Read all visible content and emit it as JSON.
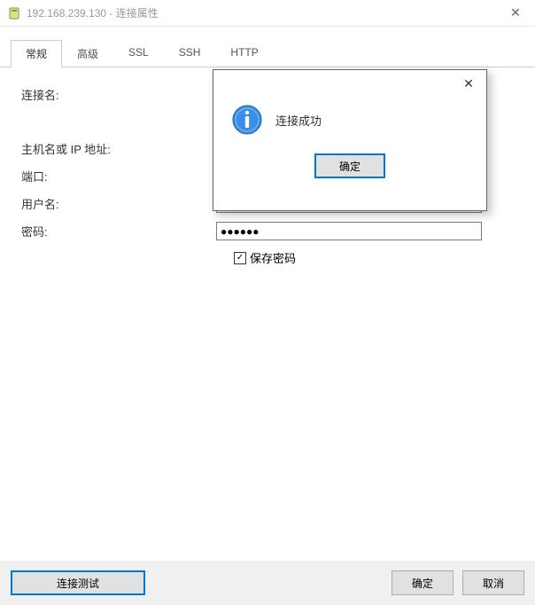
{
  "window": {
    "title": "192.168.239.130 - 连接属性",
    "close_icon": "✕"
  },
  "tabs": [
    {
      "label": "常规",
      "active": true
    },
    {
      "label": "高级",
      "active": false
    },
    {
      "label": "SSL",
      "active": false
    },
    {
      "label": "SSH",
      "active": false
    },
    {
      "label": "HTTP",
      "active": false
    }
  ],
  "form": {
    "connection_name": {
      "label": "连接名:",
      "value": ""
    },
    "host": {
      "label": "主机名或 IP 地址:",
      "value": ""
    },
    "port": {
      "label": "端口:",
      "value": ""
    },
    "username": {
      "label": "用户名:",
      "value": ""
    },
    "password": {
      "label": "密码:",
      "value": "●●●●●●"
    },
    "save_password": {
      "label": "保存密码",
      "checked": true,
      "checkmark": "✓"
    }
  },
  "buttons": {
    "test_connection": "连接测试",
    "ok": "确定",
    "cancel": "取消"
  },
  "modal": {
    "close_icon": "✕",
    "message": "连接成功",
    "ok": "确定"
  },
  "colors": {
    "accent": "#0078d7"
  }
}
